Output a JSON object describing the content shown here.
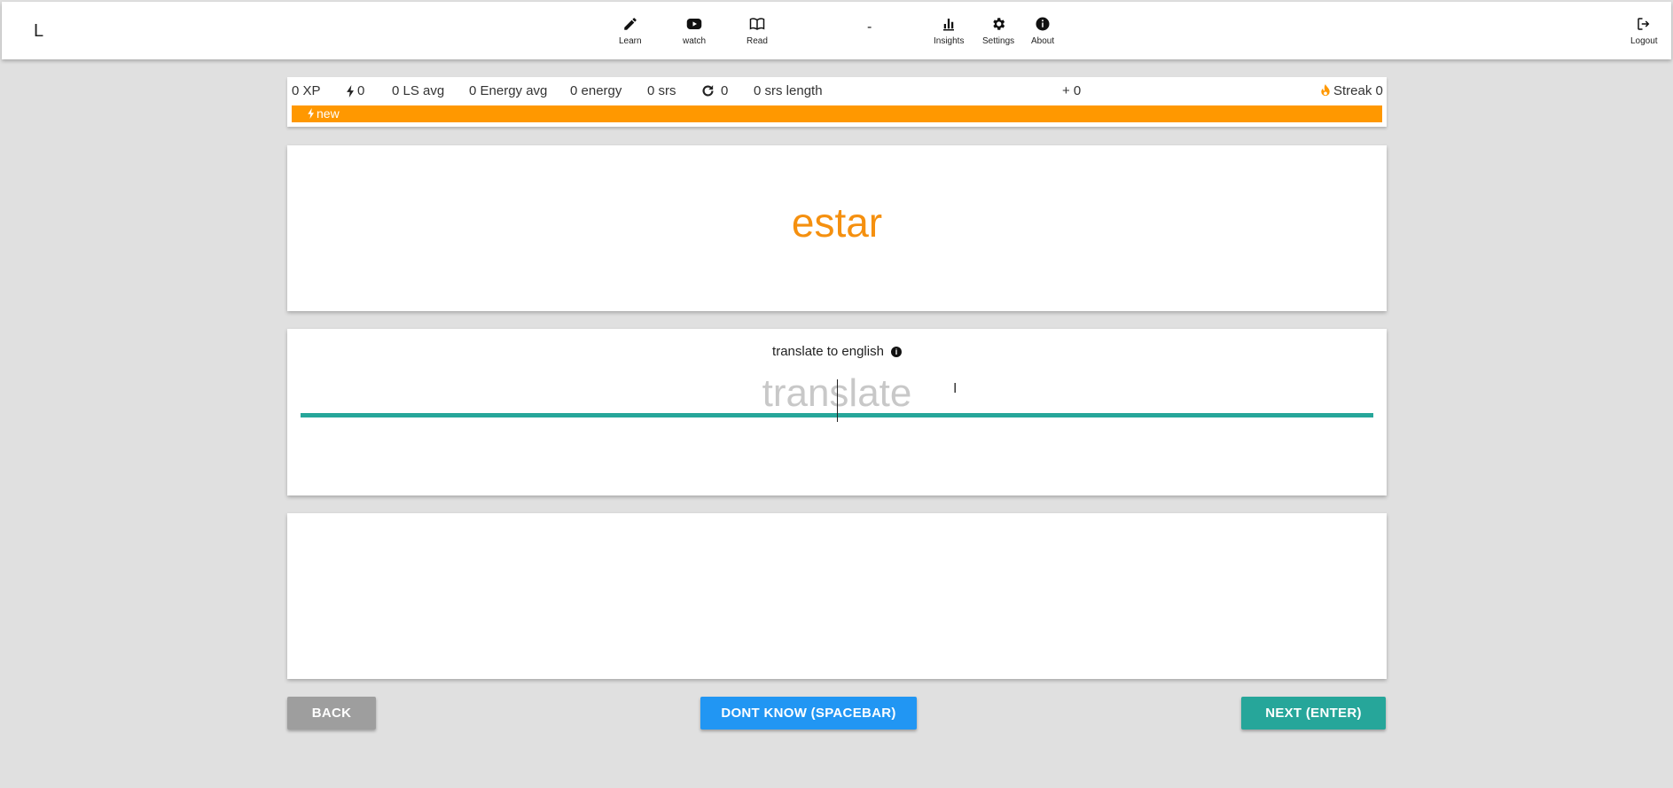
{
  "header": {
    "brand": "L",
    "nav": [
      {
        "label": "Learn",
        "icon": "pencil-icon"
      },
      {
        "label": "watch",
        "icon": "youtube-icon"
      },
      {
        "label": "Read",
        "icon": "book-icon"
      },
      {
        "label": "Insights",
        "icon": "bar-chart-icon"
      },
      {
        "label": "Settings",
        "icon": "gear-icon"
      },
      {
        "label": "About",
        "icon": "info-icon"
      }
    ],
    "center_text": "-",
    "logout": {
      "label": "Logout",
      "icon": "logout-icon"
    }
  },
  "stats": {
    "xp": "0 XP",
    "energy_count": "0",
    "ls_avg": "0 LS avg",
    "energy_avg": "0 Energy avg",
    "energy": "0 energy",
    "srs": "0 srs",
    "repeat_count": "0",
    "srs_length": "0 srs length",
    "plus": "+ 0",
    "streak": "Streak 0",
    "progress_label": "new",
    "progress_fraction": 1.0
  },
  "word": {
    "text": "estar"
  },
  "translate": {
    "instruction": "translate to english",
    "placeholder": "translate",
    "value": ""
  },
  "buttons": {
    "back": "BACK",
    "dont_know": "DONT KNOW (SPACEBAR)",
    "next": "NEXT (ENTER)"
  },
  "colors": {
    "accent_orange": "#ff9800",
    "word_orange": "#f5900f",
    "teal": "#26a69a",
    "blue": "#2196f3",
    "gray": "#9e9e9e"
  }
}
